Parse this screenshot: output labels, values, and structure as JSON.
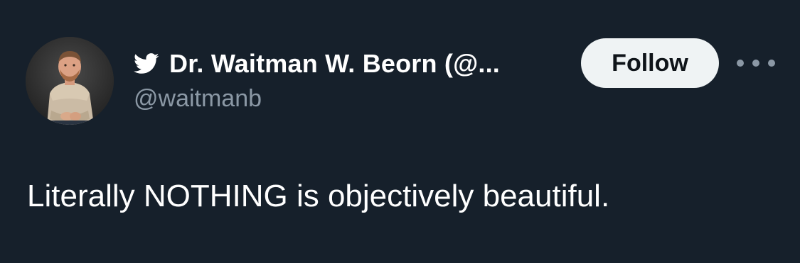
{
  "tweet": {
    "author": {
      "display_name": "Dr. Waitman W. Beorn (@...",
      "handle": "@waitmanb",
      "avatar_icon": "profile-photo",
      "platform_icon": "twitter-bird-icon"
    },
    "follow_label": "Follow",
    "more_icon": "more-options-icon",
    "text": "Literally NOTHING is objectively beautiful."
  },
  "colors": {
    "background": "#16202b",
    "primary_text": "#ffffff",
    "secondary_text": "#8b98a5",
    "follow_button_bg": "#eff3f4",
    "follow_button_text": "#0f1419"
  }
}
